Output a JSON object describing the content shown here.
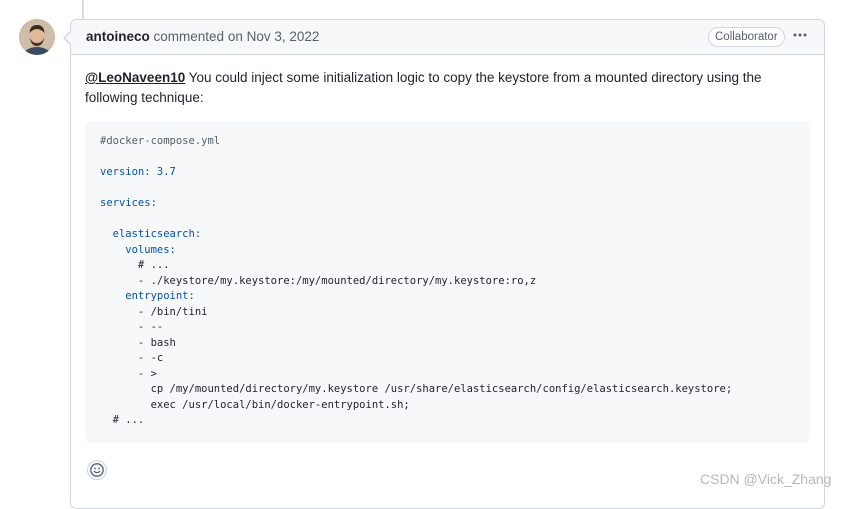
{
  "comment": {
    "author": "antoineco",
    "action": "commented on",
    "date": "Nov 3, 2022",
    "badge": "Collaborator",
    "mention": "@LeoNaveen10",
    "body": "You could inject some initialization logic to copy the keystore from a mounted directory using the following technique:"
  },
  "code": {
    "lines": [
      {
        "text": "#docker-compose.yml",
        "kind": "comment"
      },
      {
        "text": "",
        "kind": "plain"
      },
      {
        "text": "version: 3.7",
        "kind": "key"
      },
      {
        "text": "",
        "kind": "plain"
      },
      {
        "text": "services:",
        "kind": "key"
      },
      {
        "text": "",
        "kind": "plain"
      },
      {
        "text": "  elasticsearch:",
        "kind": "key"
      },
      {
        "text": "    volumes:",
        "kind": "key"
      },
      {
        "text": "      # ...",
        "kind": "plain"
      },
      {
        "text": "      - ./keystore/my.keystore:/my/mounted/directory/my.keystore:ro,z",
        "kind": "plain"
      },
      {
        "text": "    entrypoint:",
        "kind": "key"
      },
      {
        "text": "      - /bin/tini",
        "kind": "plain"
      },
      {
        "text": "      - --",
        "kind": "plain"
      },
      {
        "text": "      - bash",
        "kind": "plain"
      },
      {
        "text": "      - -c",
        "kind": "plain"
      },
      {
        "text": "      - >",
        "kind": "plain"
      },
      {
        "text": "        cp /my/mounted/directory/my.keystore /usr/share/elasticsearch/config/elasticsearch.keystore;",
        "kind": "plain"
      },
      {
        "text": "        exec /usr/local/bin/docker-entrypoint.sh;",
        "kind": "plain"
      },
      {
        "text": "  # ...",
        "kind": "plain"
      }
    ]
  },
  "watermark": "CSDN @Vick_Zhang",
  "icons": {
    "more": "kebab-horizontal-icon",
    "reaction": "smiley-icon"
  }
}
